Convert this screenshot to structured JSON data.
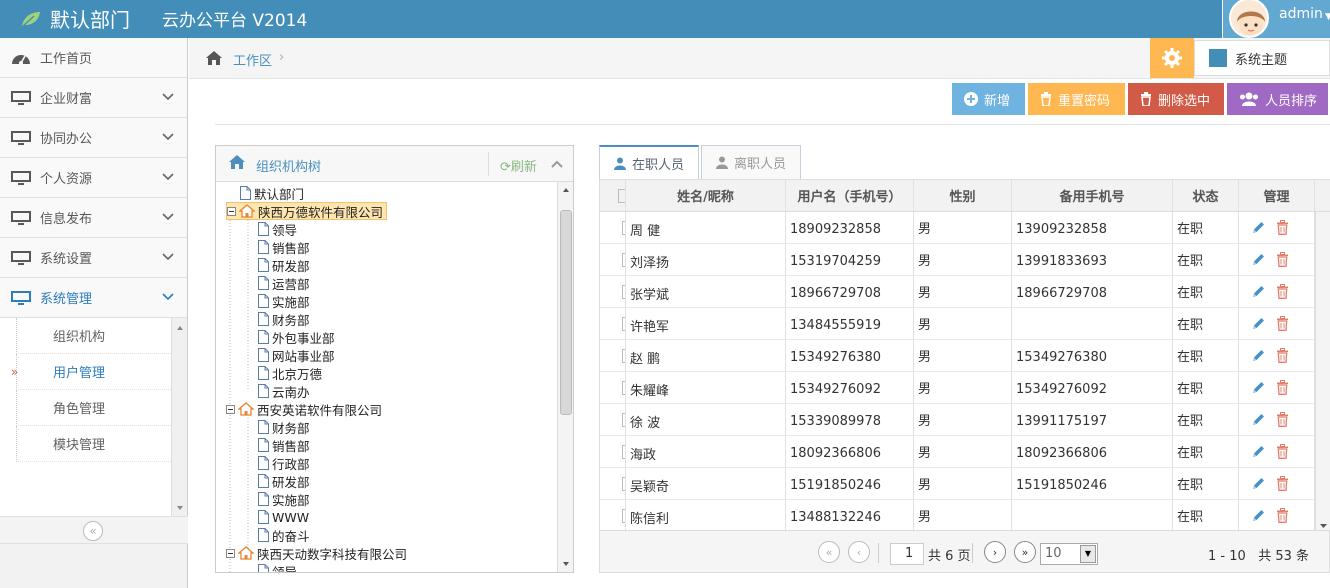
{
  "header": {
    "department": "默认部门",
    "platform": "云办公平台 V2014",
    "username": "admin"
  },
  "sidebar": {
    "items": [
      {
        "label": "工作首页",
        "icon": "dashboard-icon",
        "has_chevron": false
      },
      {
        "label": "企业财富",
        "icon": "monitor-icon",
        "has_chevron": true
      },
      {
        "label": "协同办公",
        "icon": "monitor-icon",
        "has_chevron": true
      },
      {
        "label": "个人资源",
        "icon": "monitor-icon",
        "has_chevron": true
      },
      {
        "label": "信息发布",
        "icon": "monitor-icon",
        "has_chevron": true
      },
      {
        "label": "系统设置",
        "icon": "monitor-icon",
        "has_chevron": true
      },
      {
        "label": "系统管理",
        "icon": "monitor-icon",
        "has_chevron": true,
        "active": true
      }
    ],
    "submenu": [
      {
        "label": "组织机构"
      },
      {
        "label": "用户管理",
        "active": true
      },
      {
        "label": "角色管理"
      },
      {
        "label": "模块管理"
      }
    ]
  },
  "breadcrumb": {
    "label": "工作区"
  },
  "theme": {
    "label": "系统主题",
    "color": "#438eb9"
  },
  "toolbar": {
    "add": "新增",
    "reset_password": "重置密码",
    "delete_selected": "删除选中",
    "sort_staff": "人员排序"
  },
  "org_tree": {
    "title": "组织机构树",
    "refresh": "刷新",
    "nodes": [
      {
        "label": "默认部门",
        "type": "doc",
        "level": 0
      },
      {
        "label": "陕西万德软件有限公司",
        "type": "home",
        "level": 0,
        "expanded": true,
        "selected": true
      },
      {
        "label": "领导",
        "type": "doc",
        "level": 1
      },
      {
        "label": "销售部",
        "type": "doc",
        "level": 1
      },
      {
        "label": "研发部",
        "type": "doc",
        "level": 1
      },
      {
        "label": "运营部",
        "type": "doc",
        "level": 1
      },
      {
        "label": "实施部",
        "type": "doc",
        "level": 1
      },
      {
        "label": "财务部",
        "type": "doc",
        "level": 1
      },
      {
        "label": "外包事业部",
        "type": "doc",
        "level": 1
      },
      {
        "label": "网站事业部",
        "type": "doc",
        "level": 1
      },
      {
        "label": "北京万德",
        "type": "doc",
        "level": 1
      },
      {
        "label": "云南办",
        "type": "doc",
        "level": 1
      },
      {
        "label": "西安英诺软件有限公司",
        "type": "home",
        "level": 0,
        "expanded": true
      },
      {
        "label": "财务部",
        "type": "doc",
        "level": 1
      },
      {
        "label": "销售部",
        "type": "doc",
        "level": 1
      },
      {
        "label": "行政部",
        "type": "doc",
        "level": 1
      },
      {
        "label": "研发部",
        "type": "doc",
        "level": 1
      },
      {
        "label": "实施部",
        "type": "doc",
        "level": 1
      },
      {
        "label": "WWW",
        "type": "doc",
        "level": 1
      },
      {
        "label": "的奋斗",
        "type": "doc",
        "level": 1
      },
      {
        "label": "陕西天动数字科技有限公司",
        "type": "home",
        "level": 0,
        "expanded": true
      },
      {
        "label": "领导",
        "type": "doc",
        "level": 1
      }
    ]
  },
  "tabs": [
    {
      "label": "在职人员",
      "active": true
    },
    {
      "label": "离职人员",
      "active": false
    }
  ],
  "grid": {
    "columns": [
      "姓名/昵称",
      "用户名（手机号）",
      "性别",
      "备用手机号",
      "状态",
      "管理"
    ],
    "rows": [
      [
        "周 健",
        "18909232858",
        "男",
        "13909232858",
        "在职"
      ],
      [
        "刘泽扬",
        "15319704259",
        "男",
        "13991833693",
        "在职"
      ],
      [
        "张学斌",
        "18966729708",
        "男",
        "18966729708",
        "在职"
      ],
      [
        "许艳军",
        "13484555919",
        "男",
        "",
        "在职"
      ],
      [
        "赵 鹏",
        "15349276380",
        "男",
        "15349276380",
        "在职"
      ],
      [
        "朱耀峰",
        "15349276092",
        "男",
        "15349276092",
        "在职"
      ],
      [
        "徐 波",
        "15339089978",
        "男",
        "13991175197",
        "在职"
      ],
      [
        "海政",
        "18092366806",
        "男",
        "18092366806",
        "在职"
      ],
      [
        "吴颖奇",
        "15191850246",
        "男",
        "15191850246",
        "在职"
      ],
      [
        "陈信利",
        "13488132246",
        "男",
        "",
        "在职"
      ]
    ]
  },
  "pager": {
    "page": "1",
    "total_pages": "共 6 页",
    "page_size": "10",
    "range": "1 - 10",
    "total": "共 53 条"
  }
}
